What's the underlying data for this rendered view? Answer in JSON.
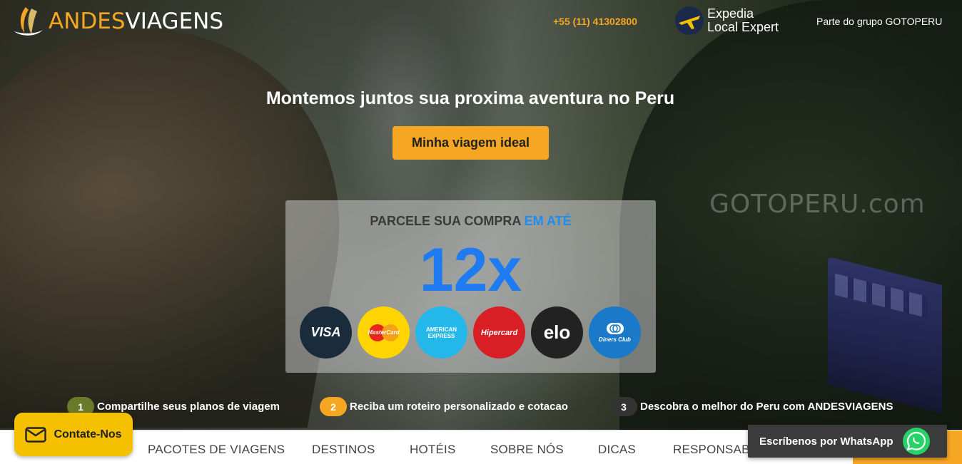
{
  "header": {
    "logo": {
      "part1": "ANDES",
      "part2": "VIAGENS"
    },
    "phone": "+55 (11) 41302800",
    "partner": {
      "line1": "Expedia",
      "line2": "Local Expert"
    },
    "group_text": "Parte do grupo GOTOPERU"
  },
  "hero": {
    "headline": "Montemos juntos sua proxima aventura no Peru",
    "cta_label": "Minha viagem ideal",
    "watermark": "GOTOPERU.com"
  },
  "installments": {
    "title_main": "PARCELE SUA COMPRA",
    "title_highlight": "EM ATÉ",
    "count": "12x",
    "cards": [
      {
        "name": "visa-logo",
        "label": "VISA"
      },
      {
        "name": "mastercard-logo",
        "label": "MasterCard"
      },
      {
        "name": "amex-logo",
        "label": "AMERICAN EXPRESS"
      },
      {
        "name": "hipercard-logo",
        "label": "Hipercard"
      },
      {
        "name": "elo-logo",
        "label": "elo"
      },
      {
        "name": "diners-logo",
        "label": "Diners Club"
      }
    ]
  },
  "steps": [
    {
      "num": "1",
      "text": "Compartilhe seus planos de viagem",
      "color": "#6b7a2a"
    },
    {
      "num": "2",
      "text": "Reciba um roteiro personalizado e cotacao",
      "color": "#f5a623"
    },
    {
      "num": "3",
      "text": "Descobra o melhor do Peru com ANDESVIAGENS",
      "color": "#333333"
    }
  ],
  "nav": {
    "items": [
      "PACOTES DE VIAGENS",
      "DESTINOS",
      "HOTÉIS",
      "SOBRE NÓS",
      "DICAS",
      "RESPONSABI"
    ]
  },
  "contact": {
    "label": "Contate-Nos"
  },
  "whatsapp": {
    "label": "Escríbenos por WhatsApp"
  },
  "colors": {
    "accent": "#f5a623",
    "blue": "#1e7bf2",
    "whatsapp": "#25d366"
  }
}
